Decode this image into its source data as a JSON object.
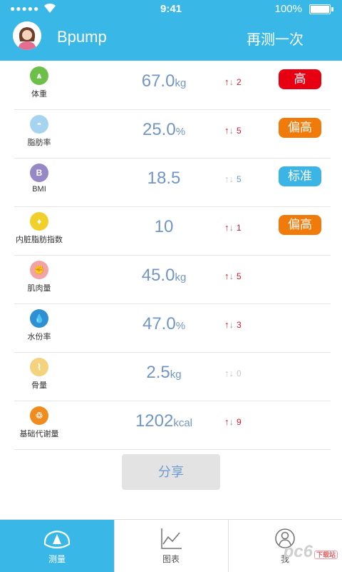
{
  "status_bar": {
    "time": "9:41",
    "battery": "100%",
    "signal": "●●●●●"
  },
  "header": {
    "title": "Bpump",
    "retest_label": "再测一次"
  },
  "metrics": [
    {
      "label": "体重",
      "value": "67.0",
      "unit": "kg",
      "change": "2",
      "icon": "weight-icon",
      "badge": "高"
    },
    {
      "label": "脂肪率",
      "value": "25.0",
      "unit": "%",
      "change": "5",
      "icon": "fat-icon",
      "badge": "偏高"
    },
    {
      "label": "BMI",
      "value": "18.5",
      "unit": "",
      "change": "5",
      "icon": "bmi-icon",
      "icon_letter": "B",
      "badge": "标准"
    },
    {
      "label": "内脏脂肪指数",
      "value": "10",
      "unit": "",
      "change": "1",
      "icon": "visceral-fat-icon",
      "badge": "偏高"
    },
    {
      "label": "肌肉量",
      "value": "45.0",
      "unit": "kg",
      "change": "5",
      "icon": "muscle-icon",
      "badge": ""
    },
    {
      "label": "水份率",
      "value": "47.0",
      "unit": "%",
      "change": "3",
      "icon": "water-drop-icon",
      "badge": ""
    },
    {
      "label": "骨量",
      "value": "2.5",
      "unit": "kg",
      "change": "0",
      "icon": "bone-icon",
      "badge": ""
    },
    {
      "label": "基础代谢量",
      "value": "1202",
      "unit": "kcal",
      "change": "9",
      "icon": "metabolism-icon",
      "badge": ""
    }
  ],
  "share_label": "分享",
  "tabs": [
    {
      "label": "测量",
      "icon": "gauge-icon",
      "active": true
    },
    {
      "label": "图表",
      "icon": "line-chart-icon",
      "active": false
    },
    {
      "label": "我",
      "icon": "user-icon",
      "active": false
    }
  ],
  "watermark": {
    "text": "pc6",
    "tag": "下载站"
  },
  "colors": {
    "primary": "#39b8e8",
    "value_text": "#7196c5",
    "badge_high": "#e60012",
    "badge_elevated": "#f07a0a",
    "badge_standard": "#3bb4e6",
    "arrow_up": "#d8172a",
    "icon_weight": "#6cc04a",
    "icon_fat": "#a6d4f0",
    "icon_bmi": "#9688c6",
    "icon_visceral": "#f2d02b",
    "icon_muscle": "#f2a3a6",
    "icon_water": "#2f8fd3",
    "icon_bone": "#f4d27e",
    "icon_metabolism": "#f08b1e"
  }
}
